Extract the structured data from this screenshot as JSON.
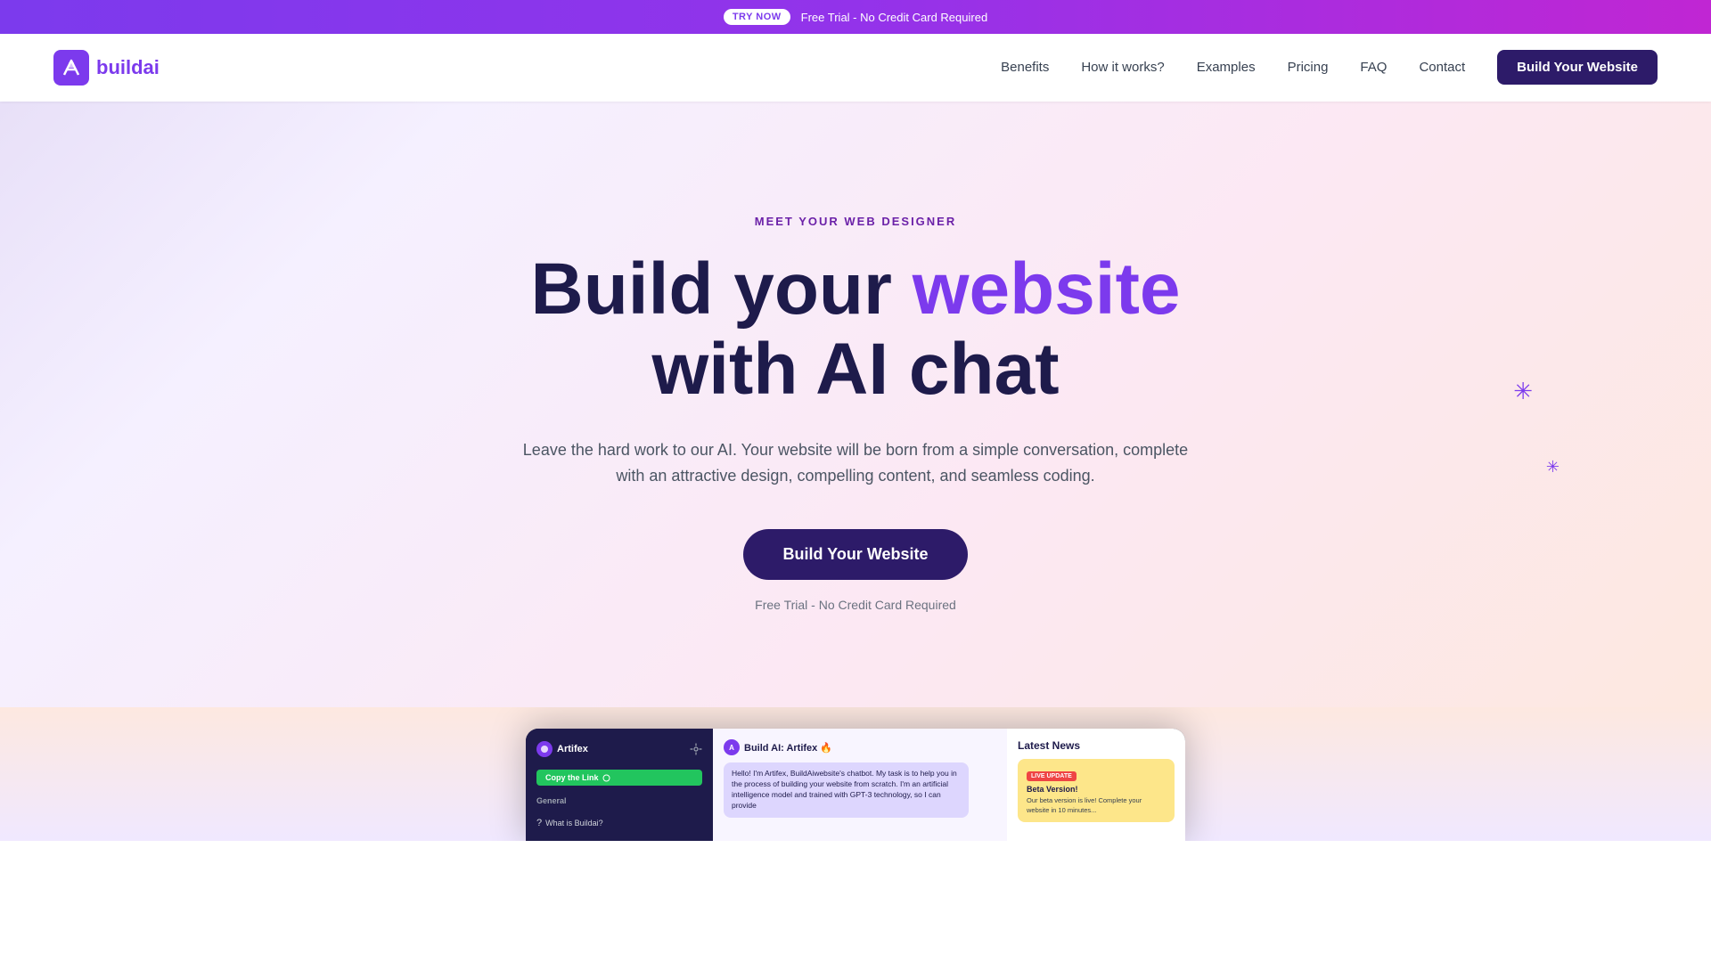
{
  "announcement": {
    "badge_label": "TRY NOW",
    "text": "Free Trial - No Credit Card Required"
  },
  "navbar": {
    "logo_text_first": "build",
    "logo_text_second": "ai",
    "nav_items": [
      {
        "label": "Benefits",
        "id": "benefits"
      },
      {
        "label": "How it works?",
        "id": "how-it-works"
      },
      {
        "label": "Examples",
        "id": "examples"
      },
      {
        "label": "Pricing",
        "id": "pricing"
      },
      {
        "label": "FAQ",
        "id": "faq"
      },
      {
        "label": "Contact",
        "id": "contact"
      }
    ],
    "cta_label": "Build Your Website"
  },
  "hero": {
    "eyebrow": "MEET YOUR WEB DESIGNER",
    "headline_part1": "Build your ",
    "headline_highlight": "website",
    "headline_part2": "with AI chat",
    "subtext": "Leave the hard work to our AI. Your website will be born from a simple conversation, complete with an attractive design, compelling content, and seamless coding.",
    "cta_label": "Build Your Website",
    "free_trial_text": "Free Trial - No Credit Card Required"
  },
  "mockup": {
    "chatbot_name": "Artifex",
    "copy_link_label": "Copy the Link",
    "general_label": "General",
    "question_text": "What is Buildai?",
    "chat_header": "Build AI: Artifex 🔥",
    "bubble_text": "Hello! I'm Artifex, BuildAiwebsite's chatbot. My task is to help you in the process of building your website from scratch. I'm an artificial intelligence model and trained with GPT-3 technology, so I can provide",
    "news_title": "Latest News",
    "news_badge": "LIVE UPDATE",
    "news_card_title": "Beta Version!",
    "news_card_body": "Our beta version is live! Complete your website in 10 minutes..."
  },
  "colors": {
    "purple_dark": "#1e1b4b",
    "purple_brand": "#7c3aed",
    "purple_nav_cta": "#2d1b69"
  }
}
